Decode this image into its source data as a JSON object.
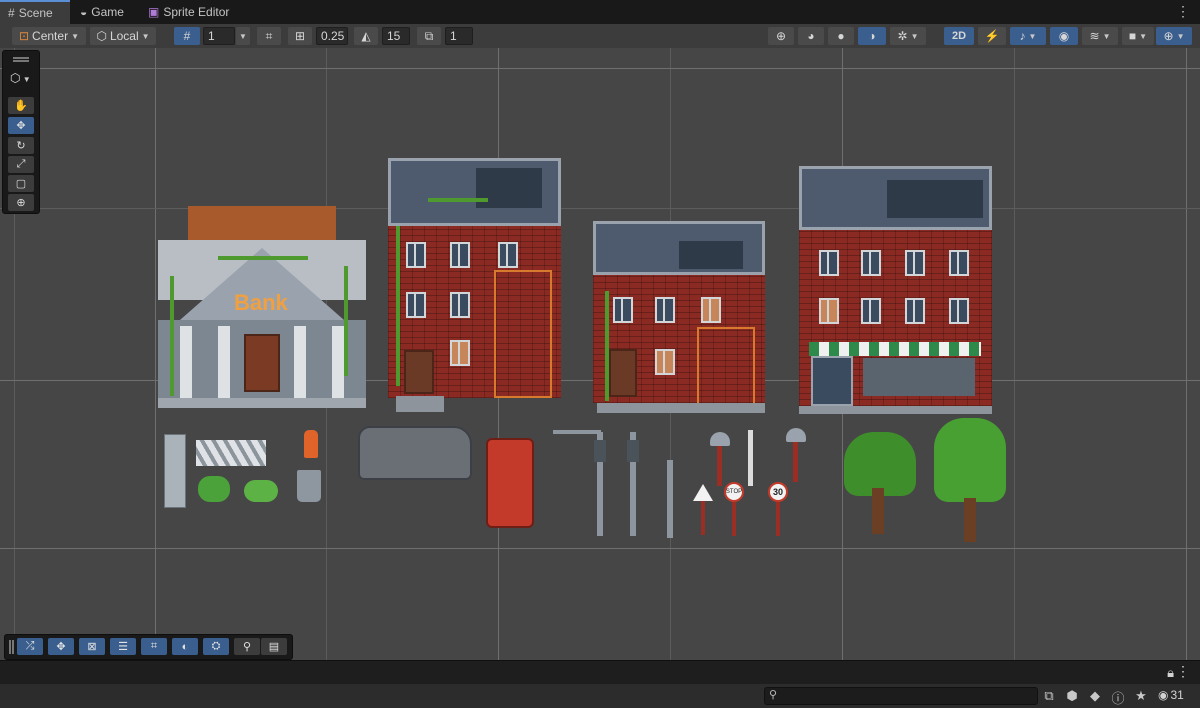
{
  "tabs": [
    {
      "label": "Scene",
      "icon": "grid-icon"
    },
    {
      "label": "Game",
      "icon": "gamepad-icon"
    },
    {
      "label": "Sprite Editor",
      "icon": "sprite-editor-icon"
    }
  ],
  "toolbar": {
    "pivot_mode": "Center",
    "pivot_rotation": "Local",
    "grid_size": "1",
    "snap_move": "0.25",
    "snap_rotate": "15",
    "snap_scale": "1",
    "mode_2d": "2D"
  },
  "scene": {
    "bank_sign": "Bank",
    "sign_stop": "STOP",
    "sign_speed": "30"
  },
  "status": {
    "visible_count": "31"
  },
  "colors": {
    "accent": "#3a5f8f",
    "tab_indicator": "#5a8fd6",
    "scene_bg": "#464646",
    "brick": "#8b2a22",
    "vine": "#4e9a2e"
  }
}
